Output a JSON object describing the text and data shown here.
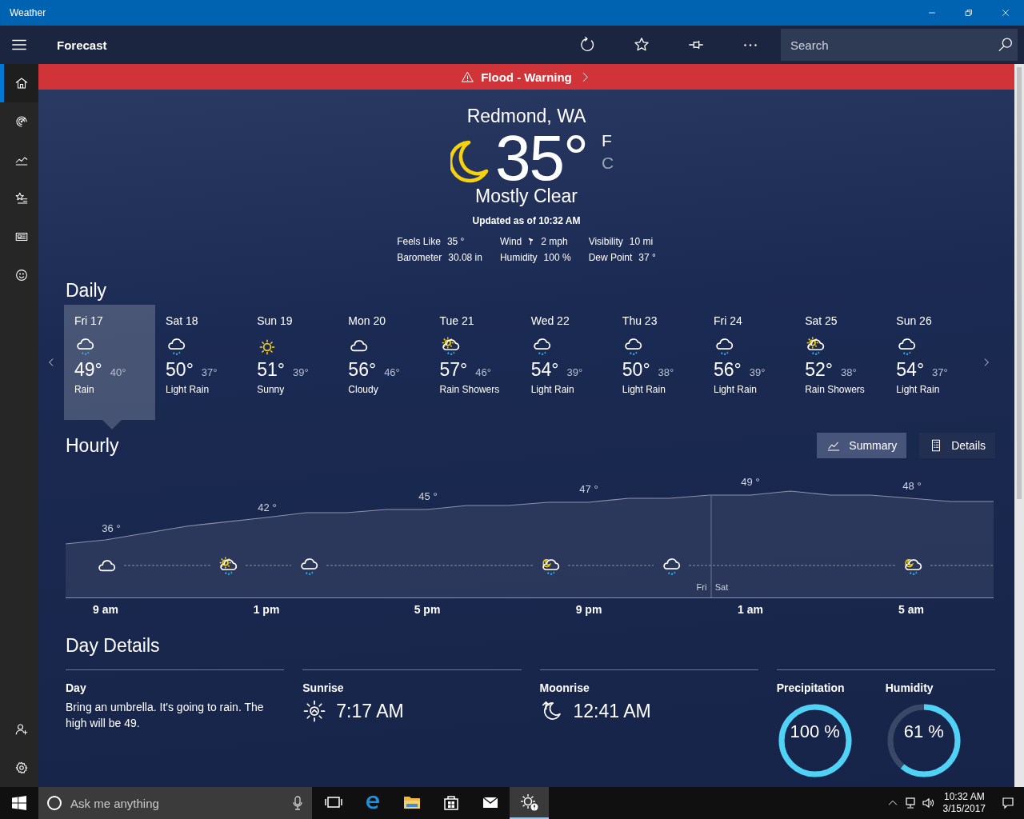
{
  "window": {
    "title": "Weather"
  },
  "header": {
    "title": "Forecast",
    "search": {
      "placeholder": "Search"
    }
  },
  "nav": {
    "items": [
      {
        "kind": "home",
        "selected": true
      },
      {
        "kind": "radar",
        "selected": false
      },
      {
        "kind": "chart",
        "selected": false
      },
      {
        "kind": "favorites",
        "selected": false
      },
      {
        "kind": "news",
        "selected": false
      },
      {
        "kind": "smiley",
        "selected": false
      }
    ],
    "bottom": [
      {
        "kind": "person-add"
      },
      {
        "kind": "settings"
      }
    ]
  },
  "alert": {
    "text": "Flood - Warning"
  },
  "current": {
    "location": "Redmond, WA",
    "temperature": "35°",
    "units": [
      {
        "label": "F",
        "selected": true
      },
      {
        "label": "C",
        "selected": false
      }
    ],
    "condition": "Mostly Clear",
    "updated": "Updated as of 10:32 AM",
    "details": [
      {
        "label": "Feels Like",
        "value": "35 °",
        "kind": "plain"
      },
      {
        "label": "Wind",
        "value": "2 mph",
        "kind": "wind"
      },
      {
        "label": "Visibility",
        "value": "10 mi",
        "kind": "plain"
      },
      {
        "label": "Barometer",
        "value": "30.08 in",
        "kind": "plain"
      },
      {
        "label": "Humidity",
        "value": "100 %",
        "kind": "plain"
      },
      {
        "label": "Dew Point",
        "value": "37 °",
        "kind": "plain"
      }
    ]
  },
  "daily": {
    "title": "Daily",
    "days": [
      {
        "day": "Fri 17",
        "kind": "rain",
        "high": "49°",
        "low": "40°",
        "condition": "Rain",
        "selected": true
      },
      {
        "day": "Sat 18",
        "kind": "rain",
        "high": "50°",
        "low": "37°",
        "condition": "Light Rain",
        "selected": false
      },
      {
        "day": "Sun 19",
        "kind": "sunny",
        "high": "51°",
        "low": "39°",
        "condition": "Sunny",
        "selected": false
      },
      {
        "day": "Mon 20",
        "kind": "cloudy",
        "high": "56°",
        "low": "46°",
        "condition": "Cloudy",
        "selected": false
      },
      {
        "day": "Tue 21",
        "kind": "sun-rain",
        "high": "57°",
        "low": "46°",
        "condition": "Rain Showers",
        "selected": false
      },
      {
        "day": "Wed 22",
        "kind": "rain",
        "high": "54°",
        "low": "39°",
        "condition": "Light Rain",
        "selected": false
      },
      {
        "day": "Thu 23",
        "kind": "rain",
        "high": "50°",
        "low": "38°",
        "condition": "Light Rain",
        "selected": false
      },
      {
        "day": "Fri 24",
        "kind": "rain",
        "high": "56°",
        "low": "39°",
        "condition": "Light Rain",
        "selected": false
      },
      {
        "day": "Sat 25",
        "kind": "sun-rain",
        "high": "52°",
        "low": "38°",
        "condition": "Rain Showers",
        "selected": false
      },
      {
        "day": "Sun 26",
        "kind": "rain",
        "high": "54°",
        "low": "37°",
        "condition": "Light Rain",
        "selected": false
      }
    ]
  },
  "hourly": {
    "title": "Hourly",
    "views": [
      {
        "label": "Summary",
        "kind": "chart",
        "selected": true
      },
      {
        "label": "Details",
        "kind": "list",
        "selected": false
      }
    ],
    "temps": [
      "36 °",
      "42 °",
      "45 °",
      "47 °",
      "49 °",
      "48 °"
    ],
    "icons": [
      {
        "kind": "cloudy"
      },
      {
        "kind": "sun-rain"
      },
      {
        "kind": "rain"
      },
      {
        "kind": "moon-rain"
      },
      {
        "kind": "rain"
      },
      {
        "kind": "moon-rain"
      }
    ],
    "day_labels": [
      "Fri",
      "Sat"
    ],
    "times": [
      "9 am",
      "1 pm",
      "5 pm",
      "9 pm",
      "1 am",
      "5 am"
    ]
  },
  "day_details": {
    "title": "Day Details",
    "day": {
      "label": "Day",
      "text": "Bring an umbrella. It's going to rain. The high will be 49."
    },
    "sunrise": {
      "label": "Sunrise",
      "value": "7:17 AM"
    },
    "moonrise": {
      "label": "Moonrise",
      "value": "12:41 AM"
    },
    "gauges": [
      {
        "label": "Precipitation",
        "value": "100 %",
        "level": 1
      },
      {
        "label": "Humidity",
        "value": "61 %",
        "level": 0.61
      }
    ]
  },
  "taskbar": {
    "search": {
      "placeholder": "Ask me anything"
    },
    "apps": [
      {
        "kind": "task-view",
        "selected": false
      },
      {
        "kind": "browser",
        "selected": false
      },
      {
        "kind": "folder",
        "selected": false
      },
      {
        "kind": "store",
        "selected": false
      },
      {
        "kind": "mail",
        "selected": false
      },
      {
        "kind": "weather",
        "selected": true
      }
    ],
    "time": "10:32 AM",
    "date": "3/15/2017"
  }
}
